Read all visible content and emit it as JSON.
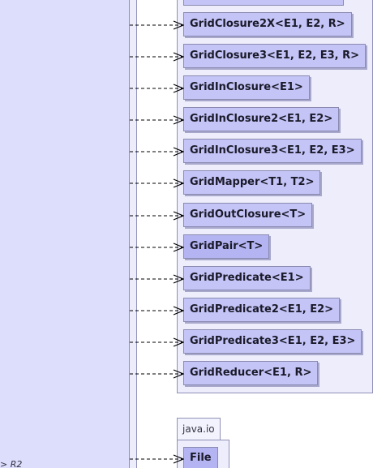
{
  "left_panel": {
    "cut_label": "> R2"
  },
  "package_top": {
    "classes": [
      {
        "name": "GridClosure2X<E1, E2, R>"
      },
      {
        "name": "GridClosure3<E1, E2, E3, R>"
      },
      {
        "name": "GridInClosure<E1>"
      },
      {
        "name": "GridInClosure2<E1, E2>"
      },
      {
        "name": "GridInClosure3<E1, E2, E3>"
      },
      {
        "name": "GridMapper<T1, T2>"
      },
      {
        "name": "GridOutClosure<T>"
      },
      {
        "name": "GridPair<T>"
      },
      {
        "name": "GridPredicate<E1>"
      },
      {
        "name": "GridPredicate2<E1, E2>"
      },
      {
        "name": "GridPredicate3<E1, E2, E3>"
      },
      {
        "name": "GridReducer<E1, R>"
      }
    ]
  },
  "package_java_io": {
    "name": "java.io",
    "classes": [
      {
        "name": "File"
      }
    ]
  },
  "colors": {
    "left_panel": "#ddddfc",
    "package_fill": "#ededfc",
    "class_fill": "#c4c4f7",
    "class_border": "#8a8ab0",
    "edge": "#000000"
  }
}
